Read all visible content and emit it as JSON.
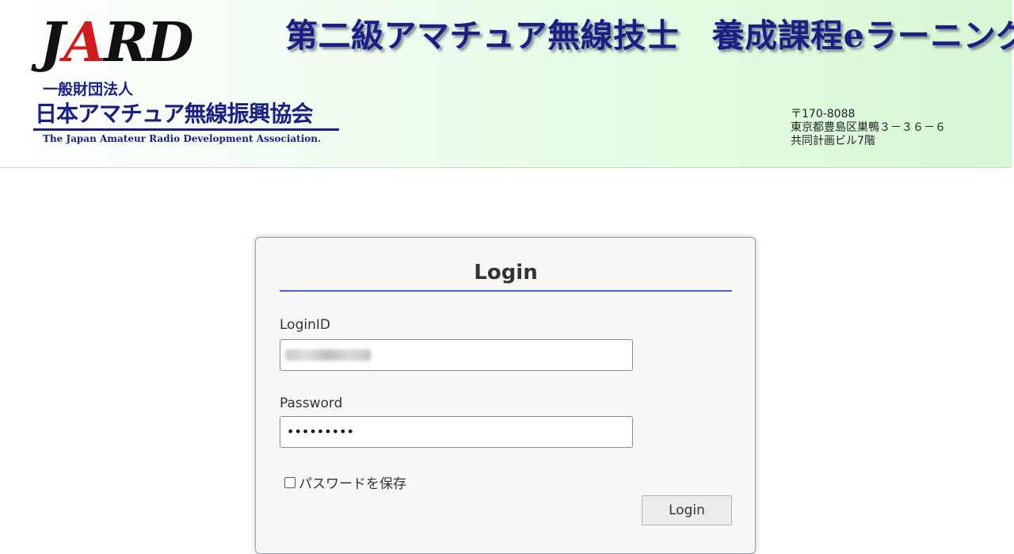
{
  "header": {
    "logo": {
      "letters_red": "A",
      "letters_before": "J",
      "letters_after": "RD"
    },
    "org_small": "一般財団法人",
    "org_main": "日本アマチュア無線振興協会",
    "org_en": "The Japan Amateur Radio Development Association.",
    "site_title": "第二級アマチュア無線技士　養成課程eラーニング",
    "address": {
      "postal": "〒170-8088",
      "line1": "東京都豊島区巣鴨３－３６－６",
      "line2": "共同計画ビル7階"
    }
  },
  "login": {
    "title": "Login",
    "id_label": "LoginID",
    "password_label": "Password",
    "password_value": "•••••••••",
    "remember_label": "パスワードを保存",
    "remember_checked": false,
    "button_label": "Login"
  },
  "colors": {
    "brand_navy": "#1a1f86",
    "logo_red": "#d21a1a",
    "login_rule": "#4a63c8",
    "header_gradient_end": "#d6f8d4"
  }
}
